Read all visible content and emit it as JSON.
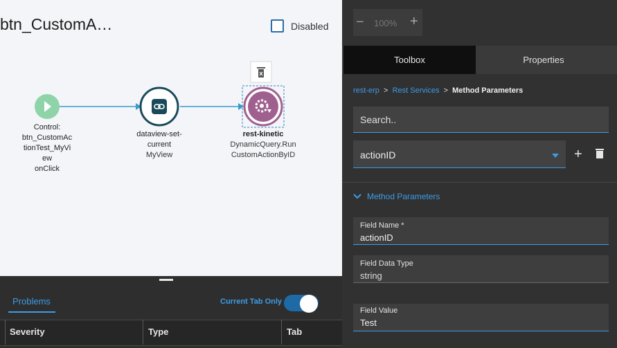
{
  "canvas": {
    "title": "btn_CustomA…",
    "disabled_label": "Disabled",
    "nodes": [
      {
        "lines": [
          "Control:",
          "btn_CustomAc",
          "tionTest_MyVi",
          "ew",
          "onClick"
        ]
      },
      {
        "lines": [
          "dataview-set-",
          "current"
        ],
        "sub": "MyView"
      },
      {
        "lines": [
          "rest-kinetic"
        ],
        "sub_lines": [
          "DynamicQuery.Run",
          "CustomActionByID"
        ]
      }
    ]
  },
  "bottom_panel": {
    "tab": "Problems",
    "toggle_label": "Current Tab Only",
    "toggle_on": true,
    "columns": [
      "Severity",
      "Type",
      "Tab"
    ]
  },
  "right_panel": {
    "zoom": {
      "minus": "−",
      "value": "100%",
      "plus": "+"
    },
    "tabs": [
      "Toolbox",
      "Properties"
    ],
    "breadcrumb": {
      "items": [
        "rest-erp",
        "Rest Services"
      ],
      "separator": ">",
      "current": "Method Parameters"
    },
    "search_placeholder": "Search..",
    "selected": "actionID",
    "add_label": "+",
    "section_title": "Method Parameters",
    "fields": [
      {
        "label": "Field Name *",
        "value": "actionID"
      },
      {
        "label": "Field Data Type",
        "value": "string"
      },
      {
        "label": "Field Value",
        "value": "Test"
      }
    ]
  },
  "colors": {
    "accent": "#3d9ce8",
    "panel": "#313131",
    "canvas": "#f3f5f8",
    "node_border": "#1a4a5a",
    "node_selected": "#a0608f",
    "start_green": "#8fd3a9"
  }
}
